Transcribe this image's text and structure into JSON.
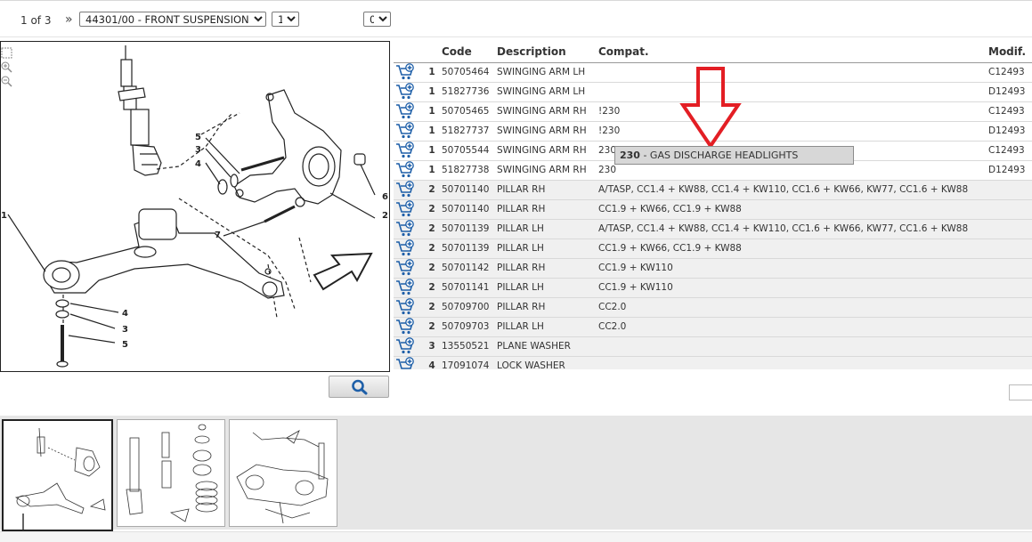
{
  "nav": {
    "page_counter": "1 of 3",
    "next_glyph": "»",
    "group_select": "44301/00 - FRONT SUSPENSION",
    "page_select": "1",
    "qty_select": "0"
  },
  "drawing": {
    "callouts": [
      "5",
      "3",
      "4",
      "7",
      "1",
      "6",
      "2",
      "4",
      "3",
      "5"
    ]
  },
  "table": {
    "headers": {
      "code": "Code",
      "description": "Description",
      "compat": "Compat.",
      "modif": "Modif."
    },
    "rows": [
      {
        "ref": "1",
        "code": "50705464",
        "description": "SWINGING ARM LH",
        "compat": "",
        "modif": "C12493"
      },
      {
        "ref": "1",
        "code": "51827736",
        "description": "SWINGING ARM LH",
        "compat": "",
        "modif": "D12493"
      },
      {
        "ref": "1",
        "code": "50705465",
        "description": "SWINGING ARM RH",
        "compat": "!230",
        "modif": "C12493"
      },
      {
        "ref": "1",
        "code": "51827737",
        "description": "SWINGING ARM RH",
        "compat": "!230",
        "modif": "D12493"
      },
      {
        "ref": "1",
        "code": "50705544",
        "description": "SWINGING ARM RH",
        "compat": "230",
        "modif": "C12493"
      },
      {
        "ref": "1",
        "code": "51827738",
        "description": "SWINGING ARM RH",
        "compat": "230",
        "modif": "D12493"
      },
      {
        "ref": "2",
        "code": "50701140",
        "description": "PILLAR RH",
        "compat": "A/TASP, CC1.4 + KW88, CC1.4 + KW110, CC1.6 + KW66, KW77, CC1.6 + KW88",
        "modif": ""
      },
      {
        "ref": "2",
        "code": "50701140",
        "description": "PILLAR RH",
        "compat": "CC1.9 + KW66, CC1.9 + KW88",
        "modif": ""
      },
      {
        "ref": "2",
        "code": "50701139",
        "description": "PILLAR LH",
        "compat": "A/TASP, CC1.4 + KW88, CC1.4 + KW110, CC1.6 + KW66, KW77, CC1.6 + KW88",
        "modif": ""
      },
      {
        "ref": "2",
        "code": "50701139",
        "description": "PILLAR LH",
        "compat": "CC1.9 + KW66, CC1.9 + KW88",
        "modif": ""
      },
      {
        "ref": "2",
        "code": "50701142",
        "description": "PILLAR RH",
        "compat": "CC1.9 + KW110",
        "modif": ""
      },
      {
        "ref": "2",
        "code": "50701141",
        "description": "PILLAR LH",
        "compat": "CC1.9 + KW110",
        "modif": ""
      },
      {
        "ref": "2",
        "code": "50709700",
        "description": "PILLAR RH",
        "compat": "CC2.0",
        "modif": ""
      },
      {
        "ref": "2",
        "code": "50709703",
        "description": "PILLAR LH",
        "compat": "CC2.0",
        "modif": ""
      },
      {
        "ref": "3",
        "code": "13550521",
        "description": "PLANE WASHER",
        "compat": "",
        "modif": ""
      },
      {
        "ref": "4",
        "code": "17091074",
        "description": "LOCK WASHER",
        "compat": "",
        "modif": ""
      }
    ]
  },
  "tooltip": {
    "code": "230",
    "text": " - GAS DISCHARGE HEADLIGHTS"
  },
  "colors": {
    "accent": "#1e5fa8",
    "annotation_arrow": "#e31e24",
    "row_alt": "#f0f0f0"
  },
  "icons": [
    "add-to-cart-icon",
    "search-icon",
    "zoom-in-icon",
    "zoom-out-icon",
    "fit-view-icon",
    "red-down-arrow-icon"
  ]
}
